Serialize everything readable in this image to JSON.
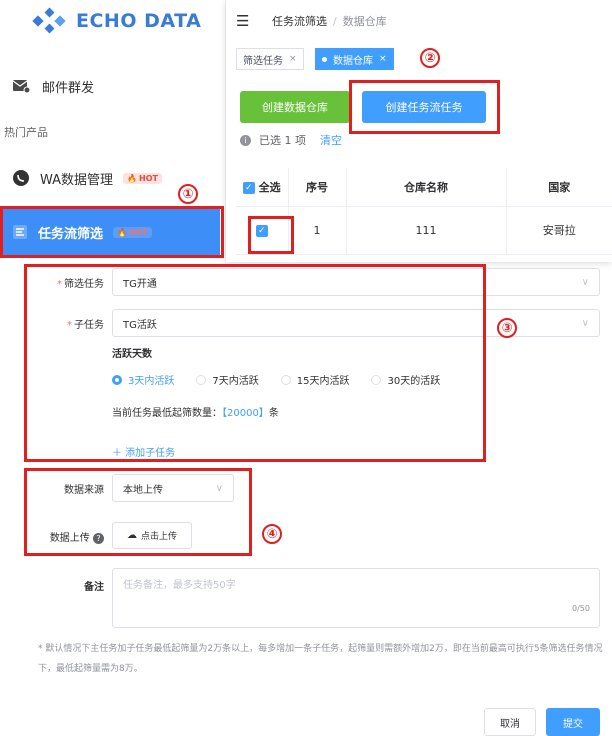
{
  "brand": {
    "logo_text": "ECHO DATA"
  },
  "sidebar": {
    "mail_label": "邮件群发",
    "section_label": "热门产品",
    "wa_label": "WA数据管理",
    "hot_badge": "HOT",
    "task_label": "任务流筛选",
    "task_badge": "HOT"
  },
  "header": {
    "crumb_1": "任务流筛选",
    "crumb_sep": "/",
    "crumb_2": "数据仓库"
  },
  "tabs": [
    {
      "label": "筛选任务",
      "close": "×"
    },
    {
      "label": "数据仓库",
      "close": "×"
    }
  ],
  "toolbar": {
    "create_warehouse": "创建数据仓库",
    "create_flow": "创建任务流任务",
    "selected_prefix": "已选",
    "selected_count": "1",
    "selected_suffix": "项",
    "clear": "清空"
  },
  "table": {
    "headers": [
      "全选",
      "序号",
      "仓库名称",
      "国家"
    ],
    "rows": [
      {
        "index": "1",
        "name": "111",
        "country": "安哥拉"
      }
    ]
  },
  "form": {
    "filter_task_label": "筛选任务",
    "filter_task_value": "TG开通",
    "sub_task_label": "子任务",
    "sub_task_value": "TG活跃",
    "active_days_label": "活跃天数",
    "radios": [
      "3天内活跃",
      "7天内活跃",
      "15天内活跃",
      "30天的活跃"
    ],
    "selected_radio": 0,
    "min_text_prefix": "当前任务最低起筛数量：",
    "min_value": "【20000】",
    "min_text_suffix": "条",
    "add_sub": "＋ 添加子任务",
    "source_label": "数据来源",
    "source_value": "本地上传",
    "upload_label": "数据上传",
    "upload_button": "点击上传",
    "remark_label": "备注",
    "remark_placeholder": "任务备注，最多支持50字",
    "remark_counter": "0/50",
    "note": "* 默认情况下主任务加子任务最低起筛量为2万条以上，每多增加一条子任务，起筛量则需额外增加2万，即在当前最高可执行5条筛选任务情况下，最低起筛量需为8万。",
    "cancel": "取消",
    "submit": "提交"
  },
  "annotations": [
    "①",
    "②",
    "③",
    "④"
  ],
  "colors": {
    "primary": "#409eff",
    "success": "#67c23a",
    "annotation": "#e02020",
    "sidebar_active": "#3e8ef7"
  }
}
